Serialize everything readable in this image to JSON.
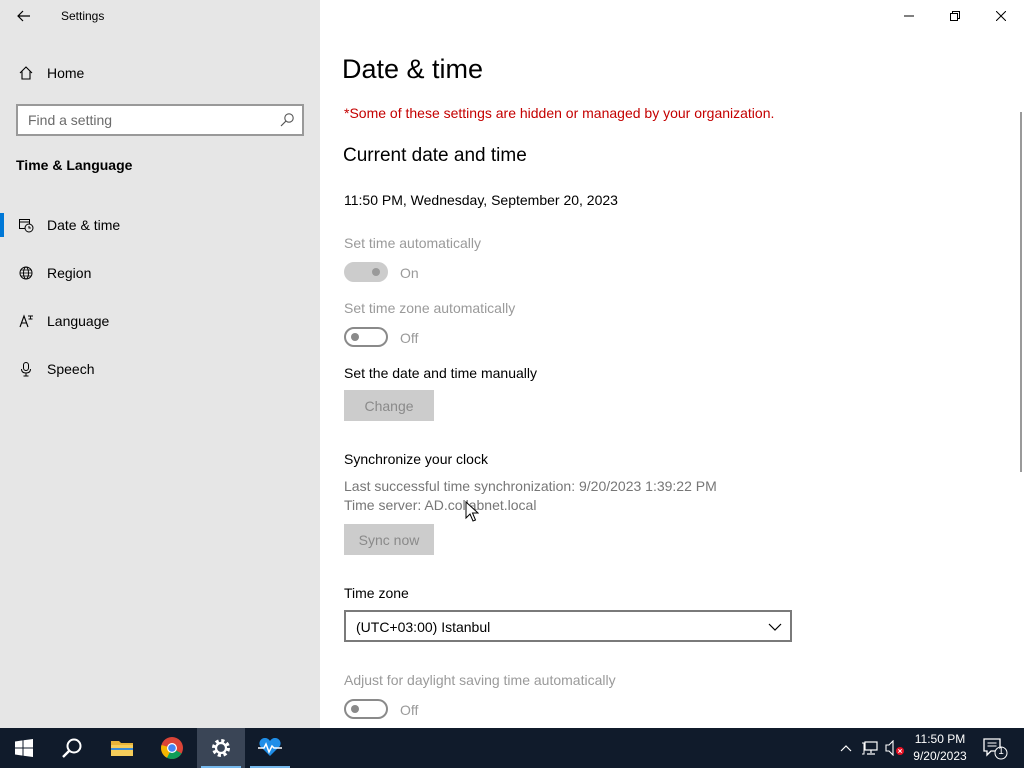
{
  "window": {
    "app_title": "Settings",
    "back_icon": "back-arrow-icon",
    "controls": [
      "minimize-icon",
      "restore-icon",
      "close-icon"
    ]
  },
  "sidebar": {
    "home_label": "Home",
    "search_placeholder": "Find a setting",
    "section": "Time & Language",
    "items": [
      {
        "label": "Date & time",
        "icon": "date-time-icon",
        "selected": true
      },
      {
        "label": "Region",
        "icon": "globe-icon",
        "selected": false
      },
      {
        "label": "Language",
        "icon": "language-icon",
        "selected": false
      },
      {
        "label": "Speech",
        "icon": "microphone-icon",
        "selected": false
      }
    ]
  },
  "main": {
    "title": "Date & time",
    "org_warning": "*Some of these settings are hidden or managed by your organization.",
    "current_heading": "Current date and time",
    "current_datetime": "11:50 PM, Wednesday, September 20, 2023",
    "set_time_auto": {
      "label": "Set time automatically",
      "state": "On"
    },
    "set_tz_auto": {
      "label": "Set time zone automatically",
      "state": "Off"
    },
    "manual": {
      "label": "Set the date and time manually",
      "button": "Change"
    },
    "sync": {
      "label": "Synchronize your clock",
      "last_sync": "Last successful time synchronization: 9/20/2023 1:39:22 PM",
      "server": "Time server: AD.collabnet.local",
      "button": "Sync now"
    },
    "timezone": {
      "label": "Time zone",
      "value": "(UTC+03:00) Istanbul"
    },
    "dst": {
      "label": "Adjust for daylight saving time automatically",
      "state": "Off"
    }
  },
  "taskbar": {
    "apps": [
      "windows-start-icon",
      "search-icon",
      "file-explorer-icon",
      "chrome-icon",
      "settings-icon",
      "health-monitor-icon"
    ],
    "tray": [
      "chevron-up-icon",
      "network-icon",
      "volume-muted-icon"
    ],
    "time": "11:50 PM",
    "date": "9/20/2023",
    "notification_count": "1"
  },
  "colors": {
    "accent": "#0078d7",
    "warning": "#c40000",
    "sidebar_bg": "#e6e6e6",
    "taskbar_bg": "#101b2b"
  }
}
